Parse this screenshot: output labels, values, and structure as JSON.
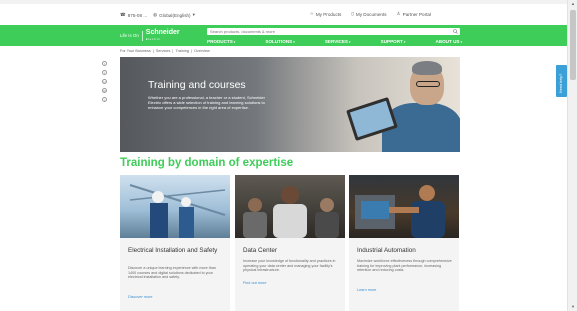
{
  "utility": {
    "contact": "875-08 ...",
    "country": "Global(English)",
    "my_products": "My Products",
    "my_documents": "My Documents",
    "partner_portal": "Partner Portal"
  },
  "nav": {
    "tagline": "Life Is On",
    "brand": "Schneider",
    "brand_sub": "Electric",
    "search_placeholder": "Search products, documents & more",
    "menu": [
      {
        "label": "PRODUCTS"
      },
      {
        "label": "SOLUTIONS"
      },
      {
        "label": "SERVICES"
      },
      {
        "label": "SUPPORT"
      },
      {
        "label": "ABOUT US"
      }
    ]
  },
  "breadcrumb": [
    "For Your Business",
    "Services",
    "Training",
    "Overview"
  ],
  "hero": {
    "title": "Training and courses",
    "text": "Whether you are a professional, a teacher or a student, Schneider Electric offers a wide selection of training and learning solutions to enhance your competences in the right area of expertise."
  },
  "section_title": "Training by domain of expertise",
  "cards": [
    {
      "title": "Electrical Installation and Safety",
      "text": "Discover a unique learning experience with more than 1400 courses and digital solutions dedicated to your electrical installation and safety.",
      "link": "Discover more"
    },
    {
      "title": "Data Center",
      "text": "Increase your knowledge of functionality and practices in operating your data center and managing your facility's physical infrastructure.",
      "link": "Find out more"
    },
    {
      "title": "Industrial Automation",
      "text": "Maximize workforce effectiveness through comprehensive training for improving plant performance, increasing retention and reducing costs.",
      "link": "Learn more"
    }
  ],
  "feedback": "Need help?",
  "colors": {
    "brand_green": "#3dcd58",
    "link_blue": "#3b8fd1",
    "feedback_blue": "#3b9fd8"
  }
}
